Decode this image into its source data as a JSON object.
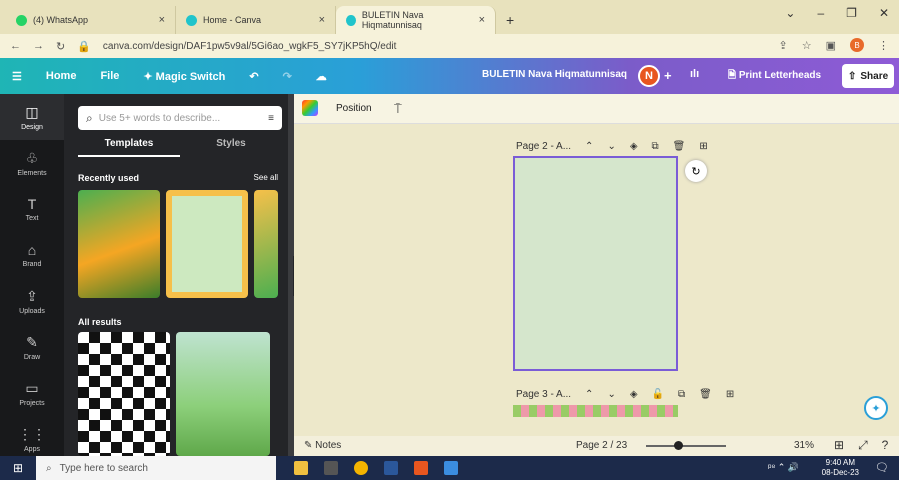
{
  "browser": {
    "tabs": [
      {
        "label": "(4) WhatsApp",
        "color": "#25d366"
      },
      {
        "label": "Home - Canva",
        "color": "#20c4cb"
      },
      {
        "label": "BULETIN Nava Hiqmatunnisaq",
        "color": "#20c4cb"
      }
    ],
    "url": "canva.com/design/DAF1pw5v9al/5Gi6ao_wgkF5_SY7jKP5hQ/edit"
  },
  "topbar": {
    "home": "Home",
    "file": "File",
    "magic": "Magic Switch",
    "doc_title": "BULETIN Nava Hiqmatunnisaq",
    "avatar": "N",
    "plus": "+",
    "print": "Print Letterheads",
    "share": "Share"
  },
  "sidebar": [
    {
      "label": "Design",
      "glyph": "◫"
    },
    {
      "label": "Elements",
      "glyph": "♧"
    },
    {
      "label": "Text",
      "glyph": "T"
    },
    {
      "label": "Brand",
      "glyph": "⌂"
    },
    {
      "label": "Uploads",
      "glyph": "⇪"
    },
    {
      "label": "Draw",
      "glyph": "✎"
    },
    {
      "label": "Projects",
      "glyph": "▭"
    },
    {
      "label": "Apps",
      "glyph": "⋮⋮"
    }
  ],
  "panel": {
    "search_placeholder": "Use 5+ words to describe...",
    "tab_templates": "Templates",
    "tab_styles": "Styles",
    "recently_used": "Recently used",
    "see_all": "See all",
    "all_results": "All results"
  },
  "canvas": {
    "position": "Position",
    "page2_label": "Page 2 - A...",
    "page3_label": "Page 3 - A..."
  },
  "bottom": {
    "notes": "Notes",
    "page": "Page 2 / 23",
    "zoom": "31%",
    "zoom_fraction": 0.4
  },
  "taskbar": {
    "search": "Type here to search",
    "time": "9:40 AM",
    "date": "08-Dec-23"
  }
}
